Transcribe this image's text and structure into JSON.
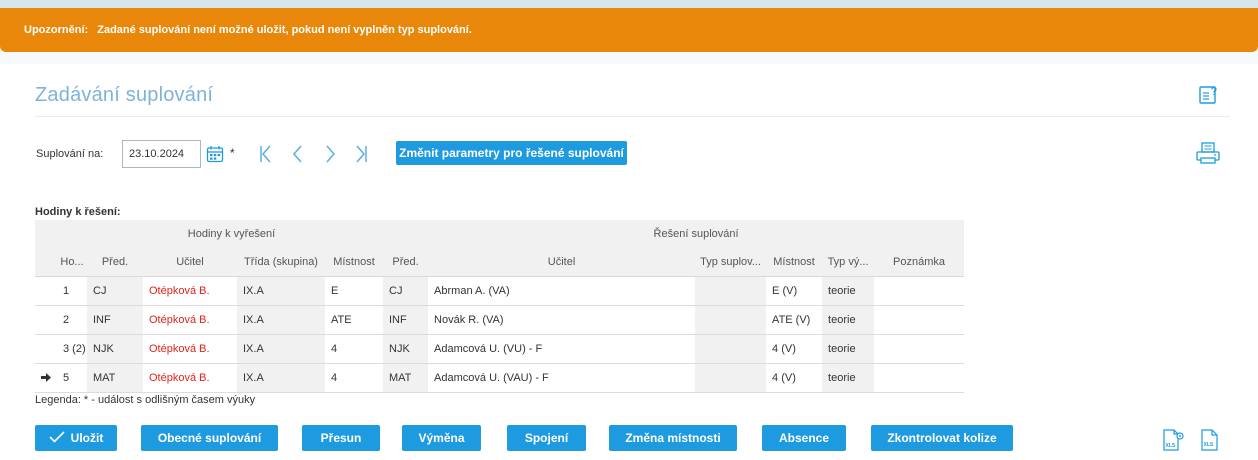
{
  "warning": {
    "label": "Upozornění:",
    "text": "Zadané suplování není možné uložit, pokud není vyplněn typ suplování."
  },
  "page": {
    "title": "Zadávání suplování",
    "icons": {
      "help": "help-doc-icon",
      "print": "print-icon"
    }
  },
  "params": {
    "label": "Suplování na:",
    "date": "23.10.2024",
    "asterisk": "*",
    "change_button": "Změnit parametry pro řešené suplování",
    "nav_icons": [
      "first-page-icon",
      "previous-icon",
      "next-icon",
      "last-page-icon"
    ]
  },
  "table": {
    "section_label": "Hodiny k řešení:",
    "group_left": "Hodiny k vyřešení",
    "group_right": "Řešení suplování",
    "columns": [
      "Ho...",
      "Před.",
      "Učitel",
      "Třída (skupina)",
      "Místnost",
      "Před.",
      "Učitel",
      "Typ suplov...",
      "Místnost",
      "Typ vý...",
      "Poznámka"
    ],
    "rows": [
      {
        "arrow": false,
        "hour": "1",
        "subject": "CJ",
        "teacher": "Otépková B.",
        "class": "IX.A",
        "room": "E",
        "new_subject": "CJ",
        "new_teacher": "Abrman A. (VA)",
        "sub_type": "",
        "new_room": "E (V)",
        "lesson_type": "teorie",
        "note": ""
      },
      {
        "arrow": false,
        "hour": "2",
        "subject": "INF",
        "teacher": "Otépková B.",
        "class": "IX.A",
        "room": "ATE",
        "new_subject": "INF",
        "new_teacher": "Novák R. (VA)",
        "sub_type": "",
        "new_room": "ATE (V)",
        "lesson_type": "teorie",
        "note": ""
      },
      {
        "arrow": false,
        "hour": "3 (2)",
        "subject": "NJK",
        "teacher": "Otépková B.",
        "class": "IX.A",
        "room": "4",
        "new_subject": "NJK",
        "new_teacher": "Adamcová U. (VU) - F",
        "sub_type": "",
        "new_room": "4 (V)",
        "lesson_type": "teorie",
        "note": ""
      },
      {
        "arrow": true,
        "hour": "5",
        "subject": "MAT",
        "teacher": "Otépková B.",
        "class": "IX.A",
        "room": "4",
        "new_subject": "MAT",
        "new_teacher": "Adamcová U. (VAU) - F",
        "sub_type": "",
        "new_room": "4 (V)",
        "lesson_type": "teorie",
        "note": ""
      }
    ]
  },
  "legend": "Legenda: * - událost s odlišným časem výuky",
  "buttons": {
    "save": "Uložit",
    "general": "Obecné suplování",
    "move": "Přesun",
    "swap": "Výměna",
    "join": "Spojení",
    "room_change": "Změna místnosti",
    "absence": "Absence",
    "check": "Zkontrolovat kolize"
  },
  "export_icons": [
    "xls-settings-icon",
    "xls-export-icon"
  ],
  "colors": {
    "warning": "#e8870a",
    "accent": "#1e9be0",
    "title": "#7fb2d8",
    "teacher_red": "#e0241b"
  }
}
